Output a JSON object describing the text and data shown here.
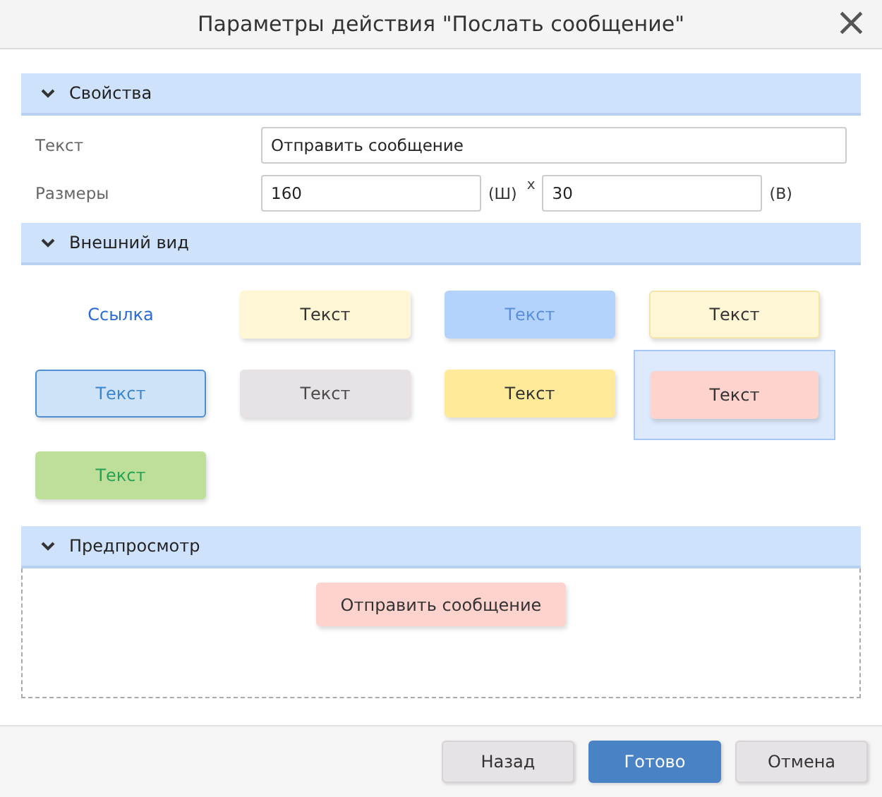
{
  "window": {
    "title": "Параметры действия \"Послать сообщение\"",
    "close": "×"
  },
  "properties": {
    "header": {
      "label": "Свойства",
      "expanded": true
    },
    "text_label": "Текст",
    "text_value": "Отправить сообщение",
    "size_label": "Размеры",
    "width_value": "160",
    "width_unit": "(Ш)",
    "times": "x",
    "height_value": "30",
    "height_unit": "(В)"
  },
  "appearance": {
    "header": {
      "label": "Внешний вид",
      "expanded": true
    },
    "styles": [
      {
        "kind": "link",
        "label": "Ссылка",
        "selected": false
      },
      {
        "kind": "cream",
        "label": "Текст",
        "selected": false
      },
      {
        "kind": "blue",
        "label": "Текст",
        "selected": false
      },
      {
        "kind": "cream-outline",
        "label": "Текст",
        "selected": false
      },
      {
        "kind": "blue-outline",
        "label": "Текст",
        "selected": false
      },
      {
        "kind": "grey",
        "label": "Текст",
        "selected": false
      },
      {
        "kind": "yellow",
        "label": "Текст",
        "selected": false
      },
      {
        "kind": "pink",
        "label": "Текст",
        "selected": true
      },
      {
        "kind": "green",
        "label": "Текст",
        "selected": false
      }
    ]
  },
  "preview": {
    "header": {
      "label": "Предпросмотр",
      "expanded": true
    },
    "button": {
      "kind": "pink",
      "label": "Отправить сообщение"
    }
  },
  "buttons": [
    {
      "label": "Назад",
      "primary": false
    },
    {
      "label": "Готово",
      "primary": true
    },
    {
      "label": "Отмена",
      "primary": false
    }
  ]
}
